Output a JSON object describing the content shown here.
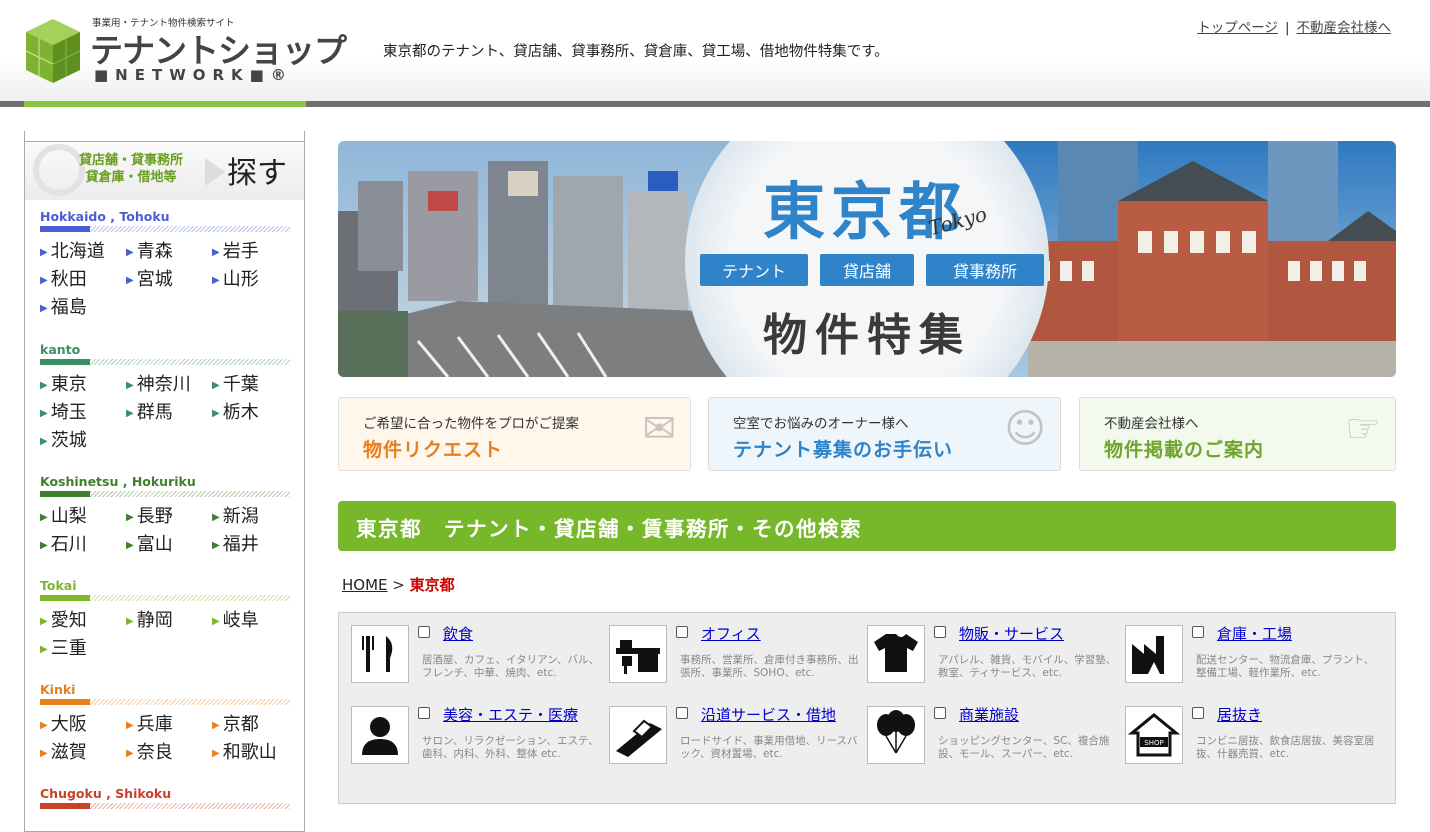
{
  "header": {
    "logo_sub": "事業用・テナント物件検索サイト",
    "logo_main": "テナントショップ",
    "logo_network": "■NETWORK■®",
    "tagline": "東京都のテナント、貸店舗、貸事務所、貸倉庫、貸工場、借地物件特集です。",
    "links": [
      {
        "label": "トップページ"
      },
      {
        "label": "不動産会社様へ"
      }
    ],
    "separator": "|"
  },
  "sidebar": {
    "heading_small_line1": "貸店舗・貸事務所",
    "heading_small_line2": "貸倉庫・借地等",
    "heading_big": "探す",
    "regions": [
      {
        "title": "Hokkaido , Tohoku",
        "color": "#4a5fd3",
        "prefs": [
          "北海道",
          "青森",
          "岩手",
          "秋田",
          "宮城",
          "山形",
          "福島"
        ]
      },
      {
        "title": "kanto",
        "color": "#3a8f63",
        "prefs": [
          "東京",
          "神奈川",
          "千葉",
          "埼玉",
          "群馬",
          "栃木",
          "茨城"
        ]
      },
      {
        "title": "Koshinetsu , Hokuriku",
        "color": "#3f7f2e",
        "prefs": [
          "山梨",
          "長野",
          "新潟",
          "石川",
          "富山",
          "福井"
        ]
      },
      {
        "title": "Tokai",
        "color": "#7fb62b",
        "prefs": [
          "愛知",
          "静岡",
          "岐阜",
          "三重"
        ]
      },
      {
        "title": "Kinki",
        "color": "#e8801a",
        "prefs": [
          "大阪",
          "兵庫",
          "京都",
          "滋賀",
          "奈良",
          "和歌山"
        ]
      },
      {
        "title": "Chugoku , Shikoku",
        "color": "#c8412a",
        "prefs": []
      }
    ]
  },
  "banner": {
    "title": "東京都",
    "title_en": "Tokyo",
    "tags": [
      "テナント",
      "貸店舗",
      "貸事務所"
    ],
    "subtitle": "物件特集"
  },
  "cards": [
    {
      "sub": "ご希望に合った物件をプロがご提案",
      "title": "物件リクエスト",
      "title_color": "#e87e1c",
      "bg": "#fff6ec",
      "icon": "envelope-icon"
    },
    {
      "sub": "空室でお悩みのオーナー様へ",
      "title": "テナント募集のお手伝い",
      "title_color": "#2f83c9",
      "bg": "#eef6fc",
      "icon": "person-icon"
    },
    {
      "sub": "不動産会社様へ",
      "title": "物件掲載のご案内",
      "title_color": "#6ea52c",
      "bg": "#f3f9ec",
      "icon": "touch-screen-icon"
    }
  ],
  "section": {
    "title": "東京都　テナント・貸店舗・賃事務所・その他検索"
  },
  "breadcrumb": {
    "home": "HOME",
    "sep": ">",
    "current": "東京都"
  },
  "categories": [
    {
      "name": "飲食",
      "desc": "居酒屋、カフェ、イタリアン、バル、フレンチ、中華、焼肉、etc.",
      "icon": "fork-knife-icon"
    },
    {
      "name": "オフィス",
      "desc": "事務所、営業所、倉庫付き事務所、出張所、事業所、SOHO、etc.",
      "icon": "office-desk-icon"
    },
    {
      "name": "物販・サービス",
      "desc": "アパレル、雑貨、モバイル、学習塾、教室、ティサービス、etc.",
      "icon": "shirt-icon"
    },
    {
      "name": "倉庫・工場",
      "desc": "配送センター、物流倉庫、プラント、整備工場、軽作業所、etc.",
      "icon": "factory-icon"
    },
    {
      "name": "美容・エステ・医療",
      "desc": "サロン、リラクゼーション、エステ、歯科、内科、外科、整体 etc.",
      "icon": "person-bust-icon"
    },
    {
      "name": "沿道サービス・借地",
      "desc": "ロードサイド、事業用借地、リースバック、資材置場、etc.",
      "icon": "roadside-icon"
    },
    {
      "name": "商業施設",
      "desc": "ショッピングセンター、SC、複合施設、モール、スーパー、etc.",
      "icon": "balloons-icon"
    },
    {
      "name": "居抜き",
      "desc": "コンビニ居抜、飲食店居抜、美容室居抜、什器売買、etc.",
      "icon": "shop-icon"
    }
  ]
}
